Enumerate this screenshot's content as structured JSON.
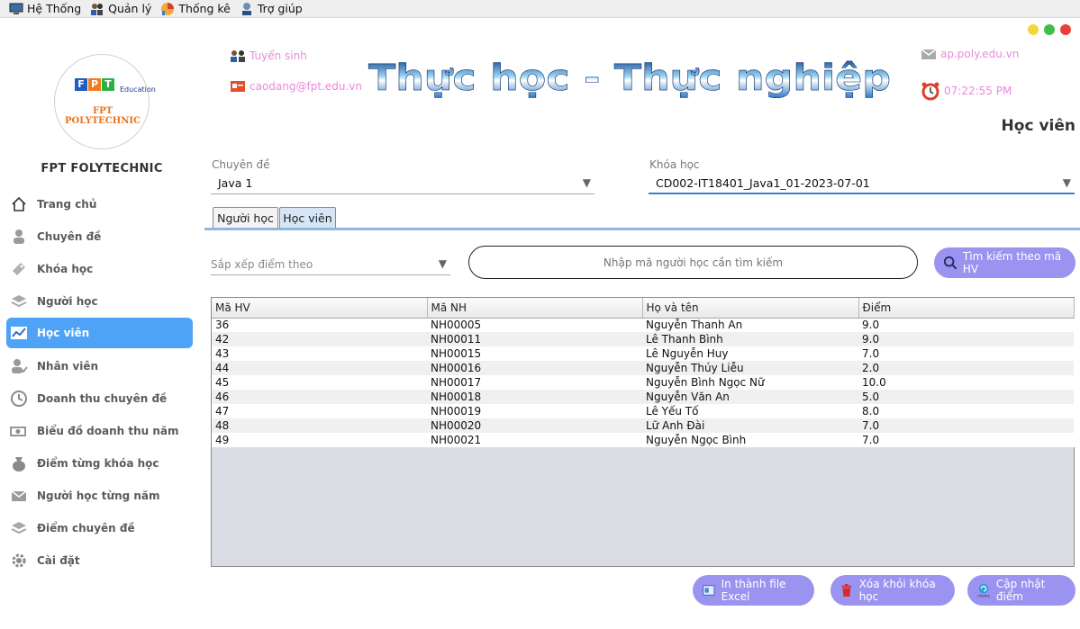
{
  "menubar": [
    {
      "label": "Hệ Thống",
      "icon": "system-icon"
    },
    {
      "label": "Quản lý",
      "icon": "people-icon"
    },
    {
      "label": "Thống kê",
      "icon": "chart-icon"
    },
    {
      "label": "Trợ giúp",
      "icon": "support-icon"
    }
  ],
  "window_controls": {
    "colors": [
      "#f5d63a",
      "#3fbf4a",
      "#e8403a"
    ]
  },
  "logo": {
    "letters": [
      "F",
      "P",
      "T"
    ],
    "letter_colors": [
      "#1e5fbf",
      "#f07a1c",
      "#2fb046"
    ],
    "edu_text": "Education",
    "school_text": "FPT POLYTECHNIC"
  },
  "brand": "FPT FOLYTECHNIC",
  "sidebar": {
    "items": [
      {
        "label": "Trang chủ",
        "icon": "home-icon"
      },
      {
        "label": "Chuyên đề",
        "icon": "topic-icon"
      },
      {
        "label": "Khóa học",
        "icon": "course-icon"
      },
      {
        "label": "Người học",
        "icon": "learner-icon"
      },
      {
        "label": "Học viên",
        "icon": "student-chart-icon"
      },
      {
        "label": "Nhân viên",
        "icon": "employee-icon"
      },
      {
        "label": "Doanh thu chuyên đề",
        "icon": "clock-icon"
      },
      {
        "label": "Biểu đồ doanh thu năm",
        "icon": "money-icon"
      },
      {
        "label": "Điểm từng khóa học",
        "icon": "bag-icon"
      },
      {
        "label": "Người học từng năm",
        "icon": "mail-icon"
      },
      {
        "label": "Điểm chuyên đề",
        "icon": "stack-icon"
      },
      {
        "label": "Cài đặt",
        "icon": "gear-icon"
      }
    ],
    "active_index": 4,
    "accent": "#4fa3f7"
  },
  "header": {
    "tuyen_sinh": "Tuyển sinh",
    "email": "caodang@fpt.edu.vn",
    "banner": "Thực học - Thực nghiệp",
    "website": "ap.poly.edu.vn",
    "clock": "07:22:55 PM",
    "link_color": "#e88adc"
  },
  "page_title": "Học viên",
  "filters": {
    "chuyen_de_label": "Chuyên đề",
    "chuyen_de_value": "Java 1",
    "khoa_hoc_label": "Khóa học",
    "khoa_hoc_value": "CD002-IT18401_Java1_01-2023-07-01"
  },
  "tabs": [
    {
      "label": "Người học",
      "selected": false
    },
    {
      "label": "Học viên",
      "selected": true
    }
  ],
  "search": {
    "sort_placeholder": "Sắp xếp điểm theo",
    "input_placeholder": "Nhập mã người học cần tìm kiếm",
    "button_label": "Tìm kiếm theo mã HV",
    "button_color": "#9b93f0"
  },
  "table": {
    "columns": [
      "Mã HV",
      "Mã NH",
      "Họ và tên",
      "Điểm"
    ],
    "rows": [
      [
        "36",
        "NH00005",
        "Nguyễn Thanh An",
        "9.0"
      ],
      [
        "42",
        "NH00011",
        "Lê Thanh Bình",
        "9.0"
      ],
      [
        "43",
        "NH00015",
        "Lê Nguyễn Huy",
        "7.0"
      ],
      [
        "44",
        "NH00016",
        "Nguyễn Thúy Liễu",
        "2.0"
      ],
      [
        "45",
        "NH00017",
        "Nguyễn Bình Ngọc Nữ",
        "10.0"
      ],
      [
        "46",
        "NH00018",
        "Nguyễn Văn An",
        "5.0"
      ],
      [
        "47",
        "NH00019",
        "Lê Yếu Tố",
        "8.0"
      ],
      [
        "48",
        "NH00020",
        "Lữ Anh Đài",
        "7.0"
      ],
      [
        "49",
        "NH00021",
        "Nguyễn Ngọc Bình",
        "7.0"
      ]
    ]
  },
  "actions": {
    "excel": "In thành file Excel",
    "delete": "Xóa khỏi khóa học",
    "update": "Cập nhật điểm",
    "update_icon_text": "UPDATE"
  }
}
